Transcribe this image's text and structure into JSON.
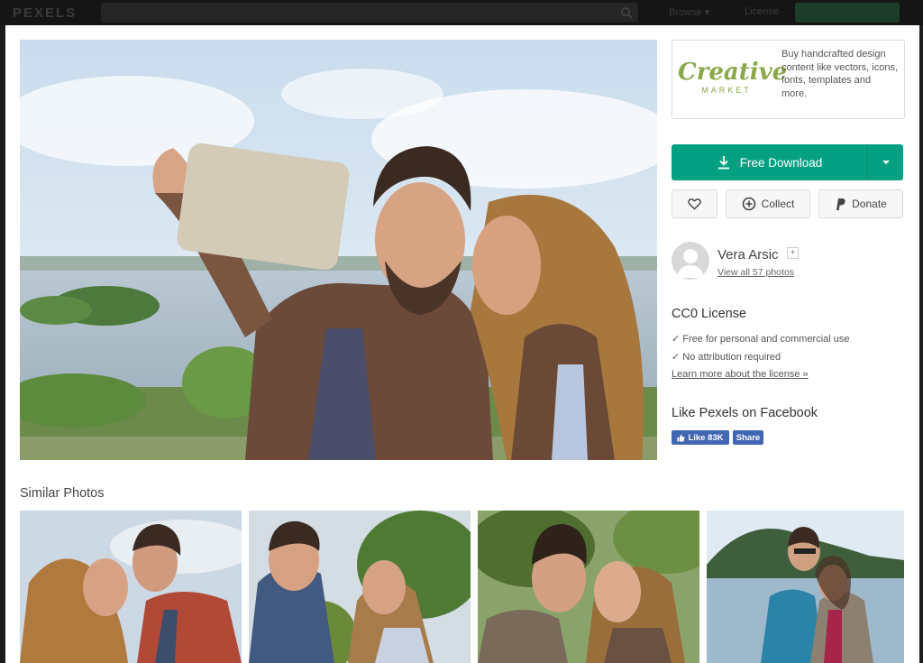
{
  "background": {
    "brand": "PEXELS",
    "nav_browse": "Browse ▾",
    "nav_license": "License"
  },
  "sidebar": {
    "ad": {
      "logo_main": "Creative",
      "logo_sub": "MARKET",
      "text": "Buy handcrafted design content like vectors, icons, fonts, templates and more."
    },
    "download": {
      "label": "Free Download",
      "icon": "download-icon",
      "dropdown_icon": "caret-down-icon"
    },
    "actions": {
      "like_icon": "heart-icon",
      "collect_label": "Collect",
      "collect_icon": "plus-circle-icon",
      "donate_label": "Donate",
      "donate_icon": "paypal-icon"
    },
    "author": {
      "name": "Vera Arsic",
      "follow": "+",
      "photos_link": "View all 57 photos"
    },
    "license": {
      "title": "CC0 License",
      "line1": "✓ Free for personal and commercial use",
      "line2": "✓ No attribution required",
      "link": "Learn more about the license »"
    },
    "facebook": {
      "title": "Like Pexels on Facebook",
      "like_label": "Like 83K",
      "share_label": "Share"
    }
  },
  "similar": {
    "title": "Similar Photos"
  },
  "colors": {
    "accent": "#05a081",
    "facebook": "#4267b2",
    "creative_market": "#8aa84a"
  }
}
